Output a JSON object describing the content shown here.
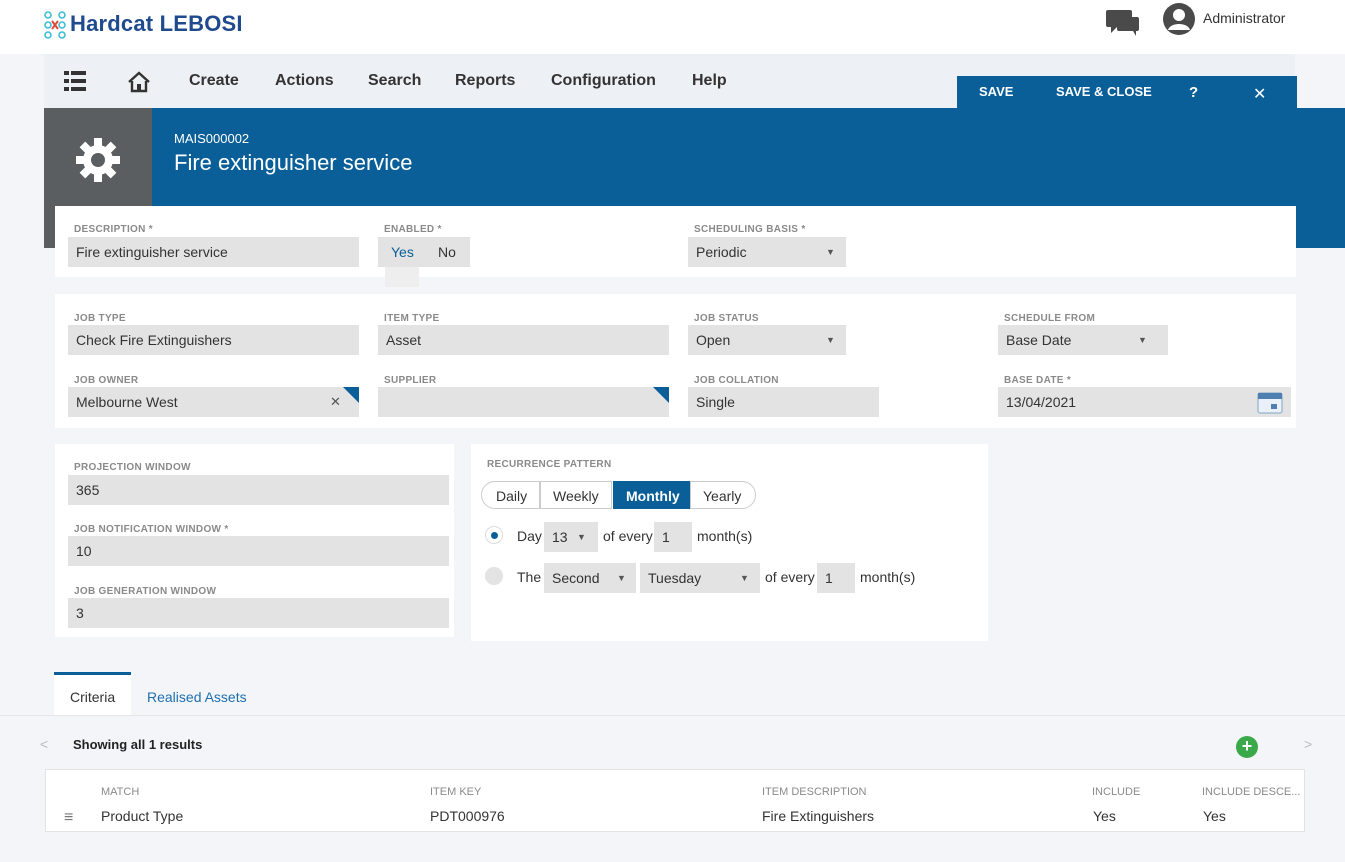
{
  "app": {
    "name": "Hardcat LEBOSI",
    "user": "Administrator"
  },
  "nav": {
    "items": [
      "Create",
      "Actions",
      "Search",
      "Reports",
      "Configuration",
      "Help"
    ]
  },
  "toolbar": {
    "save": "SAVE",
    "save_close": "SAVE & CLOSE",
    "help": "?",
    "close": "✕"
  },
  "record": {
    "id": "MAIS000002",
    "title": "Fire extinguisher service"
  },
  "form1": {
    "description_label": "DESCRIPTION *",
    "description_value": "Fire extinguisher service",
    "enabled_label": "ENABLED *",
    "enabled_yes": "Yes",
    "enabled_no": "No",
    "scheduling_label": "SCHEDULING BASIS *",
    "scheduling_value": "Periodic"
  },
  "form2": {
    "job_type_label": "JOB TYPE",
    "job_type_value": "Check Fire Extinguishers",
    "item_type_label": "ITEM TYPE",
    "item_type_value": "Asset",
    "job_status_label": "JOB STATUS",
    "job_status_value": "Open",
    "schedule_from_label": "SCHEDULE FROM",
    "schedule_from_value": "Base Date",
    "job_owner_label": "JOB OWNER",
    "job_owner_value": "Melbourne West",
    "supplier_label": "SUPPLIER",
    "supplier_value": "",
    "job_collation_label": "JOB COLLATION",
    "job_collation_value": "Single",
    "base_date_label": "BASE DATE *",
    "base_date_value": "13/04/2021"
  },
  "windows": {
    "projection_label": "PROJECTION WINDOW",
    "projection_value": "365",
    "notification_label": "JOB NOTIFICATION WINDOW *",
    "notification_value": "10",
    "generation_label": "JOB GENERATION WINDOW",
    "generation_value": "3"
  },
  "recurrence": {
    "label": "RECURRENCE PATTERN",
    "options": [
      "Daily",
      "Weekly",
      "Monthly",
      "Yearly"
    ],
    "selected": "Monthly",
    "row1": {
      "day": "Day",
      "day_value": "13",
      "of_every": "of every",
      "months_value": "1",
      "unit": "month(s)"
    },
    "row2": {
      "the": "The",
      "ordinal": "Second",
      "weekday": "Tuesday",
      "of_every": "of every",
      "months_value": "1",
      "unit": "month(s)"
    }
  },
  "tabs": [
    "Criteria",
    "Realised Assets"
  ],
  "results": {
    "summary": "Showing all 1 results"
  },
  "grid": {
    "headers": [
      "MATCH",
      "ITEM KEY",
      "ITEM DESCRIPTION",
      "INCLUDE",
      "INCLUDE DESCE..."
    ],
    "rows": [
      [
        "Product Type",
        "PDT000976",
        "Fire Extinguishers",
        "Yes",
        "Yes"
      ]
    ]
  },
  "colors": {
    "brand": "#0a5f98",
    "accent_green": "#3aa94a"
  }
}
